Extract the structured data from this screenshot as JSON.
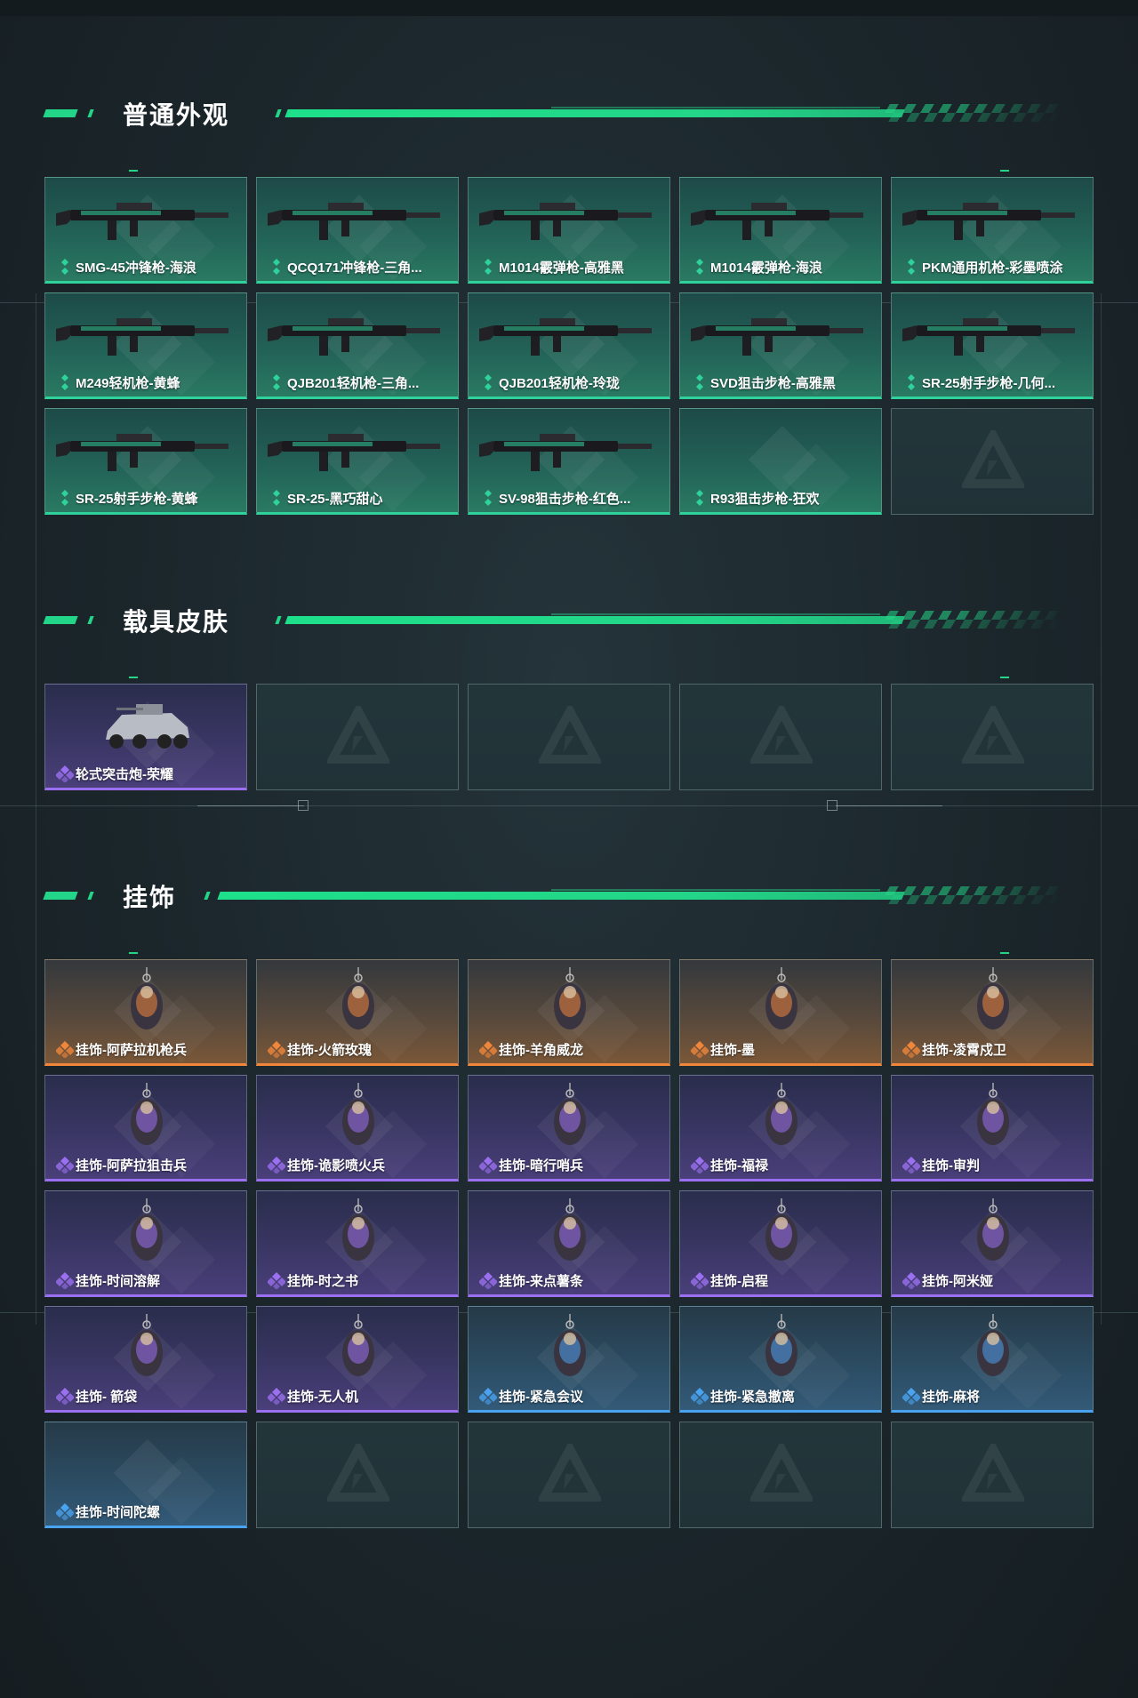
{
  "sections": [
    {
      "title": "普通外观",
      "items": [
        {
          "label": "SMG-45冲锋枪-海浪",
          "rarity": "green",
          "icon": "smg-weapon-icon"
        },
        {
          "label": "QCQ171冲锋枪-三角...",
          "rarity": "green",
          "icon": "smg-weapon-icon"
        },
        {
          "label": "M1014霰弹枪-高雅黑",
          "rarity": "green",
          "icon": "shotgun-weapon-icon"
        },
        {
          "label": "M1014霰弹枪-海浪",
          "rarity": "green",
          "icon": "shotgun-weapon-icon"
        },
        {
          "label": "PKM通用机枪-彩墨喷涂",
          "rarity": "green",
          "icon": "machine-gun-weapon-icon"
        },
        {
          "label": "M249轻机枪-黄蜂",
          "rarity": "green",
          "icon": "machine-gun-weapon-icon"
        },
        {
          "label": "QJB201轻机枪-三角...",
          "rarity": "green",
          "icon": "machine-gun-weapon-icon"
        },
        {
          "label": "QJB201轻机枪-玲珑",
          "rarity": "green",
          "icon": "machine-gun-weapon-icon"
        },
        {
          "label": "SVD狙击步枪-高雅黑",
          "rarity": "green",
          "icon": "sniper-rifle-weapon-icon"
        },
        {
          "label": "SR-25射手步枪-几何...",
          "rarity": "green",
          "icon": "rifle-weapon-icon"
        },
        {
          "label": "SR-25射手步枪-黄蜂",
          "rarity": "green",
          "icon": "rifle-weapon-icon"
        },
        {
          "label": "SR-25-黑巧甜心",
          "rarity": "green",
          "icon": "rifle-weapon-icon"
        },
        {
          "label": "SV-98狙击步枪-红色...",
          "rarity": "green",
          "icon": "sniper-rifle-weapon-icon"
        },
        {
          "label": "R93狙击步枪-狂欢",
          "rarity": "green",
          "icon": "none"
        },
        {
          "label": "",
          "rarity": "empty",
          "icon": "none"
        }
      ]
    },
    {
      "title": "载具皮肤",
      "items": [
        {
          "label": "轮式突击炮-荣耀",
          "rarity": "purple",
          "icon": "armored-vehicle-icon"
        },
        {
          "label": "",
          "rarity": "empty",
          "icon": "none"
        },
        {
          "label": "",
          "rarity": "empty",
          "icon": "none"
        },
        {
          "label": "",
          "rarity": "empty",
          "icon": "none"
        },
        {
          "label": "",
          "rarity": "empty",
          "icon": "none"
        }
      ]
    },
    {
      "title": "挂饰",
      "items": [
        {
          "label": "挂饰-阿萨拉机枪兵",
          "rarity": "orange",
          "icon": "charm-figure-icon"
        },
        {
          "label": "挂饰-火箭玫瑰",
          "rarity": "orange",
          "icon": "charm-figure-icon"
        },
        {
          "label": "挂饰-羊角威龙",
          "rarity": "orange",
          "icon": "charm-figure-icon"
        },
        {
          "label": "挂饰-墨",
          "rarity": "orange",
          "icon": "charm-tag-icon"
        },
        {
          "label": "挂饰-凌霄戍卫",
          "rarity": "orange",
          "icon": "charm-figure-icon"
        },
        {
          "label": "挂饰-阿萨拉狙击兵",
          "rarity": "purple",
          "icon": "charm-figure-icon"
        },
        {
          "label": "挂饰-诡影喷火兵",
          "rarity": "purple",
          "icon": "charm-figure-icon"
        },
        {
          "label": "挂饰-暗行哨兵",
          "rarity": "purple",
          "icon": "charm-figure-icon"
        },
        {
          "label": "挂饰-福禄",
          "rarity": "purple",
          "icon": "charm-gourd-icon"
        },
        {
          "label": "挂饰-审判",
          "rarity": "purple",
          "icon": "charm-tag-icon"
        },
        {
          "label": "挂饰-时间溶解",
          "rarity": "purple",
          "icon": "charm-figure-icon"
        },
        {
          "label": "挂饰-时之书",
          "rarity": "purple",
          "icon": "charm-book-icon"
        },
        {
          "label": "挂饰-来点薯条",
          "rarity": "purple",
          "icon": "charm-fries-icon"
        },
        {
          "label": "挂饰-启程",
          "rarity": "purple",
          "icon": "charm-ring-icon"
        },
        {
          "label": "挂饰-阿米娅",
          "rarity": "purple",
          "icon": "charm-figure-icon"
        },
        {
          "label": "挂饰- 箭袋",
          "rarity": "purple",
          "icon": "charm-quiver-icon"
        },
        {
          "label": "挂饰-无人机",
          "rarity": "purple",
          "icon": "charm-drone-icon"
        },
        {
          "label": "挂饰-紧急会议",
          "rarity": "blue",
          "icon": "charm-badge-icon"
        },
        {
          "label": "挂饰-紧急撤离",
          "rarity": "blue",
          "icon": "charm-tag-icon"
        },
        {
          "label": "挂饰-麻将",
          "rarity": "blue",
          "icon": "charm-mahjong-icon"
        },
        {
          "label": "挂饰-时间陀螺",
          "rarity": "blue",
          "icon": "none"
        },
        {
          "label": "",
          "rarity": "empty",
          "icon": "none"
        },
        {
          "label": "",
          "rarity": "empty",
          "icon": "none"
        },
        {
          "label": "",
          "rarity": "empty",
          "icon": "none"
        },
        {
          "label": "",
          "rarity": "empty",
          "icon": "none"
        }
      ]
    }
  ],
  "colors": {
    "accent": "#23d588",
    "green": "#2fd29a",
    "purple": "#9a6ff0",
    "orange": "#f0863a",
    "blue": "#4aa3f0"
  }
}
